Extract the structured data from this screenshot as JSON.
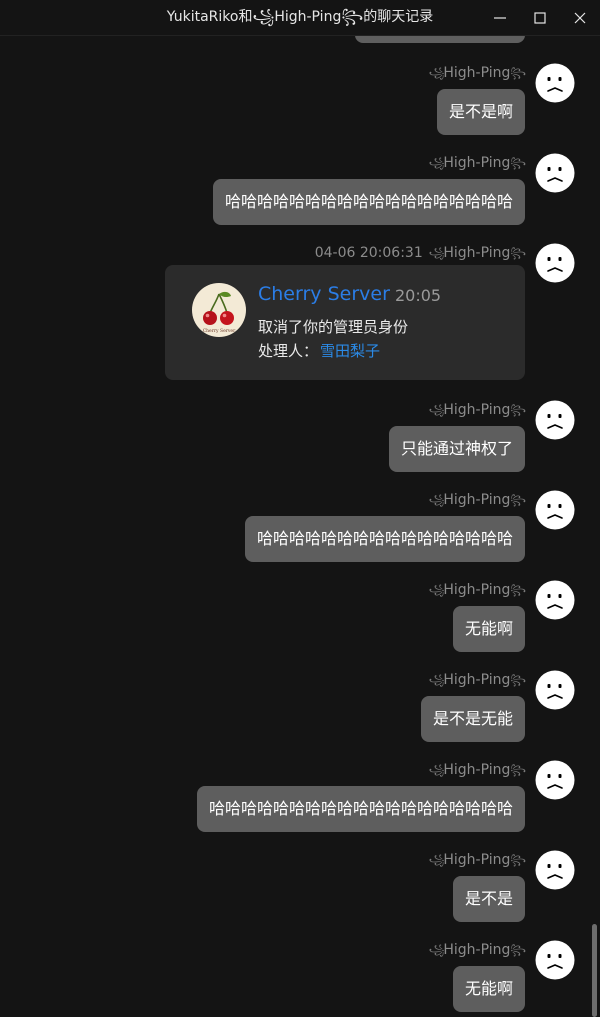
{
  "window": {
    "title": "YukitaRiko和꧁High-Ping꧂的聊天记录",
    "controls": {
      "minimize_icon": "minimize-icon",
      "maximize_icon": "maximize-icon",
      "close_icon": "close-icon"
    }
  },
  "sender": {
    "name_prefix": "꧁",
    "name": "High-Ping",
    "name_suffix": "꧂",
    "avatar": "neutral-face-icon"
  },
  "messages": [
    {
      "time": "",
      "text": "是不是啊"
    },
    {
      "time": "",
      "text": "哈哈哈哈哈哈哈哈哈哈哈哈哈哈哈哈哈哈"
    },
    {
      "time": "04-06 20:06:31",
      "card": {
        "name": "Cherry Server",
        "time": "20:05",
        "line1": "取消了你的管理员身份",
        "line2_label": "处理人：",
        "line2_handler": "雪田梨子",
        "logo_icon": "cherry-logo-icon",
        "logo_text": "Cherry Server"
      }
    },
    {
      "time": "",
      "text": "只能通过神权了"
    },
    {
      "time": "",
      "text": "哈哈哈哈哈哈哈哈哈哈哈哈哈哈哈哈"
    },
    {
      "time": "",
      "text": "无能啊"
    },
    {
      "time": "",
      "text": "是不是无能"
    },
    {
      "time": "",
      "text": "哈哈哈哈哈哈哈哈哈哈哈哈哈哈哈哈哈哈哈"
    },
    {
      "time": "",
      "text": "是不是"
    },
    {
      "time": "",
      "text": "无能啊"
    }
  ],
  "colors": {
    "background": "#141414",
    "bubble": "#5e5e5e",
    "card": "#2b2b2b",
    "link_blue": "#2b7de6"
  }
}
